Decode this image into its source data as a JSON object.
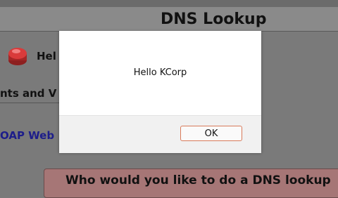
{
  "page": {
    "title": "DNS Lookup",
    "help_text": "Hel",
    "section_heading": "nts and V",
    "soap_link": "OAP Web",
    "banner_text": "Who would you like to do a DNS lookup"
  },
  "dialog": {
    "message": "Hello KCorp",
    "ok_label": "OK"
  },
  "colors": {
    "overlay_background": "#7a7a7a",
    "banner_background": "#a67676",
    "link_blue": "#1d1d8a",
    "ok_button_border": "#d87a5a"
  },
  "icons": {
    "help": "red-help-button-icon"
  }
}
